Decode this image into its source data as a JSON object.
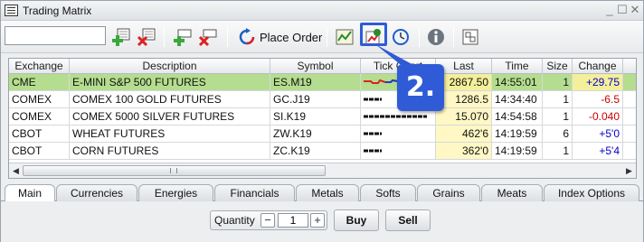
{
  "window": {
    "title": "Trading Matrix",
    "minimize_glyph": "_",
    "maximize_glyph": "☐",
    "close_glyph": "✕"
  },
  "toolbar": {
    "symbol_input_value": "",
    "place_order_label": "Place Order",
    "icons": [
      "add-green-icon",
      "remove-red-icon",
      "add-row-icon",
      "remove-row-icon",
      "place-order-icon",
      "chart-icon",
      "tick-chart-icon",
      "clock-chart-icon",
      "info-icon",
      "export-icon"
    ],
    "highlighted_button": "tick-chart-icon"
  },
  "callout": {
    "label": "2."
  },
  "grid": {
    "columns": [
      "Exchange",
      "Description",
      "Symbol",
      "Tick Chart",
      "Last",
      "Time",
      "Size",
      "Change"
    ],
    "rows": [
      {
        "exchange": "CME",
        "description": "E-MINI S&P 500 FUTURES",
        "symbol": "ES.M19",
        "last": "2867.50",
        "time": "14:55:01",
        "size": "1",
        "change": "+29.75",
        "change_dir": "up",
        "selected": true
      },
      {
        "exchange": "COMEX",
        "description": "COMEX 100 GOLD FUTURES",
        "symbol": "GC.J19",
        "last": "1286.5",
        "time": "14:34:40",
        "size": "1",
        "change": "-6.5",
        "change_dir": "down",
        "selected": false
      },
      {
        "exchange": "COMEX",
        "description": "COMEX 5000 SILVER FUTURES",
        "symbol": "SI.K19",
        "last": "15.070",
        "time": "14:54:58",
        "size": "1",
        "change": "-0.040",
        "change_dir": "down",
        "selected": false
      },
      {
        "exchange": "CBOT",
        "description": "WHEAT FUTURES",
        "symbol": "ZW.K19",
        "last": "462'6",
        "time": "14:19:59",
        "size": "6",
        "change": "+5'0",
        "change_dir": "up",
        "selected": false
      },
      {
        "exchange": "CBOT",
        "description": "CORN FUTURES",
        "symbol": "ZC.K19",
        "last": "362'0",
        "time": "14:19:59",
        "size": "1",
        "change": "+5'4",
        "change_dir": "up",
        "selected": false
      }
    ]
  },
  "tabs": [
    "Main",
    "Currencies",
    "Energies",
    "Financials",
    "Metals",
    "Softs",
    "Grains",
    "Meats",
    "Index Options"
  ],
  "active_tab": "Main",
  "bottom": {
    "quantity_label": "Quantity",
    "minus_glyph": "−",
    "plus_glyph": "+",
    "quantity_value": "1",
    "buy_label": "Buy",
    "sell_label": "Sell"
  },
  "colors": {
    "selected_row": "#b5dd8f",
    "last_cell": "#fff7c4",
    "positive_change": "#0000cc",
    "negative_change": "#cc0000",
    "callout": "#2f5bd6"
  }
}
